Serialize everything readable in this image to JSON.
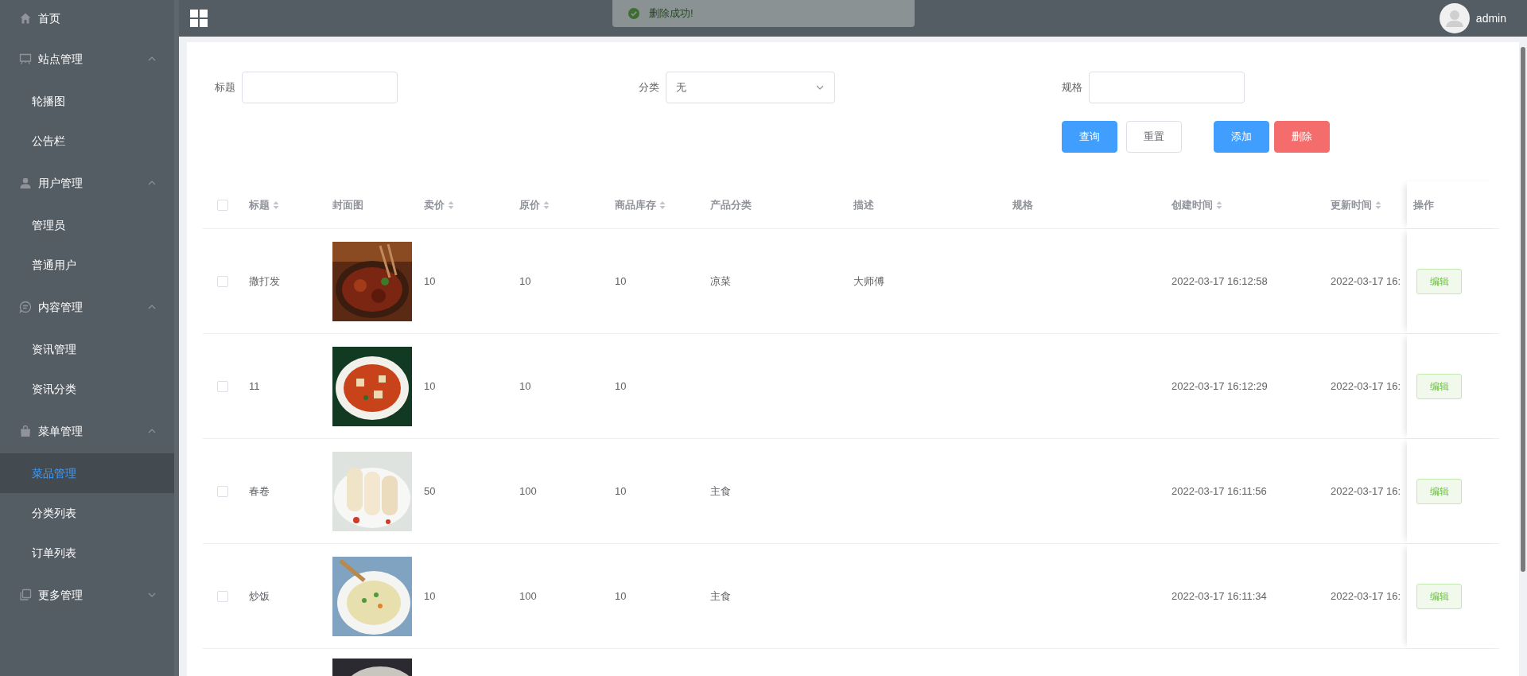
{
  "sidebar": {
    "items": [
      {
        "kind": "link",
        "label": "首页",
        "selected": false
      },
      {
        "kind": "group",
        "label": "站点管理",
        "expanded": true,
        "children": [
          {
            "label": "轮播图",
            "selected": false
          },
          {
            "label": "公告栏",
            "selected": false
          }
        ]
      },
      {
        "kind": "group",
        "label": "用户管理",
        "expanded": true,
        "children": [
          {
            "label": "管理员",
            "selected": false
          },
          {
            "label": "普通用户",
            "selected": false
          }
        ]
      },
      {
        "kind": "group",
        "label": "内容管理",
        "expanded": true,
        "children": [
          {
            "label": "资讯管理",
            "selected": false
          },
          {
            "label": "资讯分类",
            "selected": false
          }
        ]
      },
      {
        "kind": "group",
        "label": "菜单管理",
        "expanded": true,
        "children": [
          {
            "label": "菜品管理",
            "selected": true
          },
          {
            "label": "分类列表",
            "selected": false
          },
          {
            "label": "订单列表",
            "selected": false
          }
        ]
      },
      {
        "kind": "group",
        "label": "更多管理",
        "expanded": false
      }
    ]
  },
  "topbar": {
    "toast": "删除成功!",
    "user": "admin"
  },
  "filters": {
    "title": {
      "label": "标题"
    },
    "category": {
      "label": "分类",
      "value": "无"
    },
    "spec": {
      "label": "规格"
    }
  },
  "buttons": [
    {
      "kind": "primary",
      "label": "查询"
    },
    {
      "kind": "plain",
      "label": "重置"
    },
    {
      "kind": "primary",
      "label": "添加"
    },
    {
      "kind": "danger",
      "label": "删除"
    }
  ],
  "table": {
    "select_all_checked": false,
    "columns": [
      {
        "label": "标题",
        "sortable": true
      },
      {
        "label": "封面图",
        "sortable": false
      },
      {
        "label": "卖价",
        "sortable": true
      },
      {
        "label": "原价",
        "sortable": true
      },
      {
        "label": "商品库存",
        "sortable": true
      },
      {
        "label": "产品分类",
        "sortable": false
      },
      {
        "label": "描述",
        "sortable": false
      },
      {
        "label": "规格",
        "sortable": false
      },
      {
        "label": "创建时间",
        "sortable": true
      },
      {
        "label": "更新时间",
        "sortable": true
      },
      {
        "label": "操作",
        "sortable": false
      }
    ],
    "rows": [
      {
        "checked": false,
        "title": "撒打发",
        "price": "10",
        "original_price": "10",
        "stock": "10",
        "category": "凉菜",
        "description": "大师傅",
        "created": "2022-03-17 16:12:58",
        "updated": "2022-03-17 16:",
        "action": "编辑"
      },
      {
        "checked": false,
        "title": "11",
        "price": "10",
        "original_price": "10",
        "stock": "10",
        "created": "2022-03-17 16:12:29",
        "updated": "2022-03-17 16:",
        "action": "编辑"
      },
      {
        "checked": false,
        "title": "春卷",
        "price": "50",
        "original_price": "100",
        "stock": "10",
        "category": "主食",
        "created": "2022-03-17 16:11:56",
        "updated": "2022-03-17 16:",
        "action": "编辑"
      },
      {
        "checked": false,
        "title": "炒饭",
        "price": "10",
        "original_price": "100",
        "stock": "10",
        "category": "主食",
        "created": "2022-03-17 16:11:34",
        "updated": "2022-03-17 16:",
        "action": "编辑"
      }
    ]
  }
}
